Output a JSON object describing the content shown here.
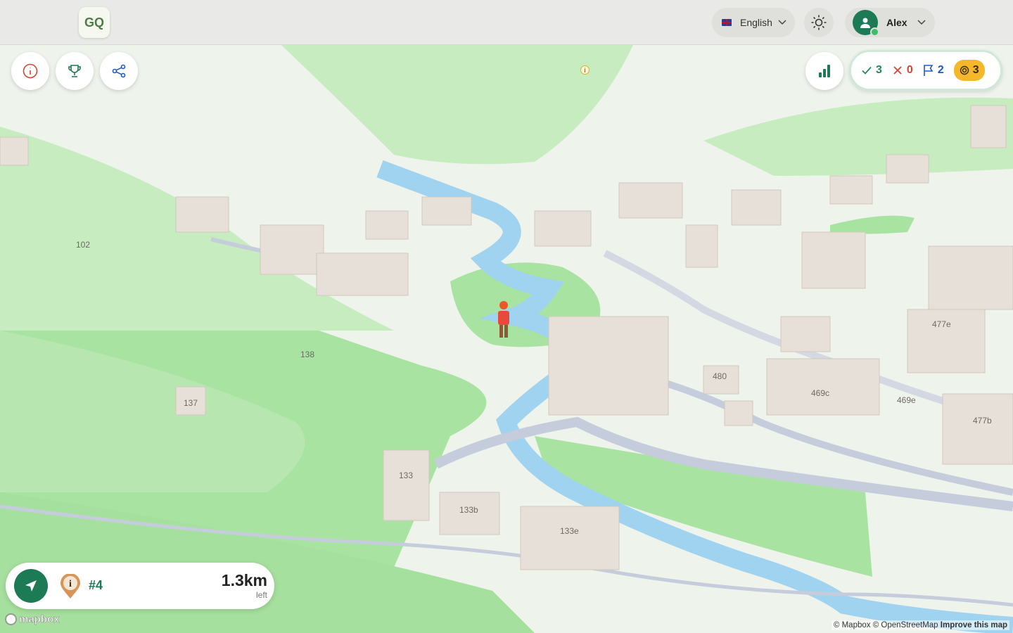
{
  "header": {
    "logo_text": "GQ",
    "language": "English",
    "user_name": "Alex"
  },
  "toolbar": {
    "info_icon": "info-icon",
    "trophy_icon": "trophy-icon",
    "share_icon": "share-icon",
    "stats_icon": "bar-chart-icon"
  },
  "score": {
    "correct": "3",
    "wrong": "0",
    "flags": "2",
    "coins": "3"
  },
  "target": {
    "number": "#4",
    "distance": "1.3km",
    "distance_unit": "left"
  },
  "map": {
    "building_labels": [
      "102",
      "138",
      "137",
      "133",
      "133b",
      "133e",
      "480",
      "469e",
      "469c",
      "477e",
      "477b"
    ],
    "info_marker": "i"
  },
  "footer": {
    "mapbox": "mapbox",
    "attribution_1": "© Mapbox",
    "attribution_2": "© OpenStreetMap",
    "attribution_3": "Improve this map"
  },
  "colors": {
    "brand_green": "#1c7a54",
    "grass": "#a8e2a0",
    "water": "#9fd3f0",
    "building": "#e6e0d8",
    "coin": "#f5b82a"
  }
}
